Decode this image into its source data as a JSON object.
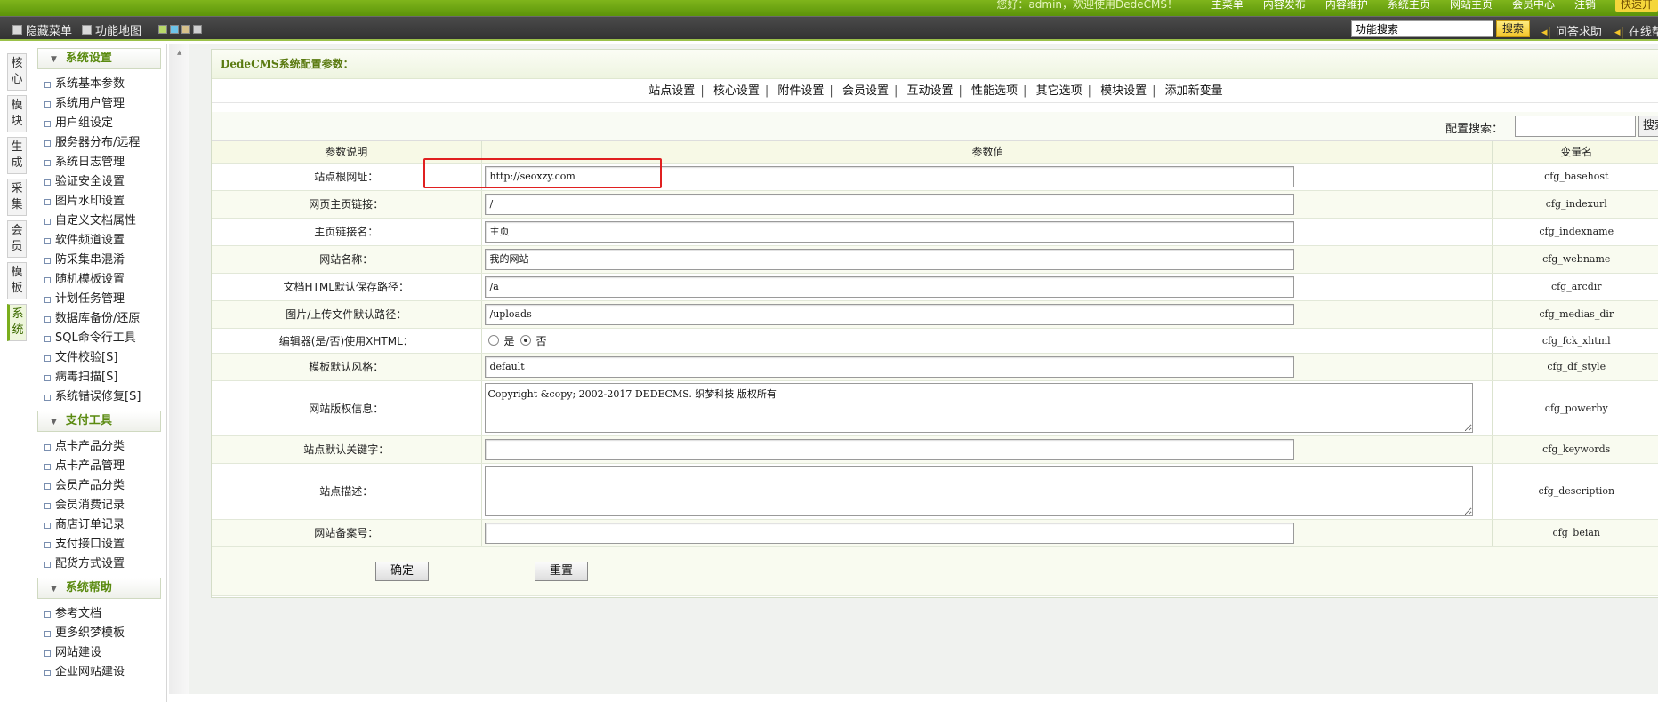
{
  "topbar": {
    "welcome": "您好：admin，欢迎使用DedeCMS！",
    "links": [
      "主菜单",
      "内容发布",
      "内容维护",
      "系统主页",
      "网站主页",
      "会员中心",
      "注销",
      "快速开"
    ]
  },
  "toolbar": {
    "hide_menu": "隐藏菜单",
    "func_map": "功能地图",
    "search_value": "功能搜索",
    "search_btn": "搜索",
    "help": "问答求助",
    "online": "在线帮",
    "swatch_colors": [
      "#b8d86a",
      "#6cc3e8",
      "#d6c08a",
      "#d0d0d0"
    ]
  },
  "vtabs": [
    "核心",
    "模块",
    "生成",
    "采集",
    "会员",
    "模板",
    "系统"
  ],
  "sidebar": {
    "sections": [
      {
        "title": "系统设置",
        "items": [
          "系统基本参数",
          "系统用户管理",
          "用户组设定",
          "服务器分布/远程",
          "系统日志管理",
          "验证安全设置",
          "图片水印设置",
          "自定义文档属性",
          "软件频道设置",
          "防采集串混淆",
          "随机模板设置",
          "计划任务管理",
          "数据库备份/还原",
          "SQL命令行工具",
          "文件校验[S]",
          "病毒扫描[S]",
          "系统错误修复[S]"
        ]
      },
      {
        "title": "支付工具",
        "items": [
          "点卡产品分类",
          "点卡产品管理",
          "会员产品分类",
          "会员消费记录",
          "商店订单记录",
          "支付接口设置",
          "配货方式设置"
        ]
      },
      {
        "title": "系统帮助",
        "items": [
          "参考文档",
          "更多织梦模板",
          "网站建设",
          "企业网站建设"
        ]
      }
    ]
  },
  "panel": {
    "title": "DedeCMS系统配置参数：",
    "nav": [
      "站点设置",
      "核心设置",
      "附件设置",
      "会员设置",
      "互动设置",
      "性能选项",
      "其它选项",
      "模块设置",
      "添加新变量"
    ],
    "cfg_search_label": "配置搜索：",
    "cfg_search_btn": "搜索",
    "headers": [
      "参数说明",
      "参数值",
      "变量名"
    ],
    "rows": [
      {
        "label": "站点根网址：",
        "type": "text",
        "value": "http://seoxzy.com",
        "var": "cfg_basehost"
      },
      {
        "label": "网页主页链接：",
        "type": "text",
        "value": "/",
        "var": "cfg_indexurl"
      },
      {
        "label": "主页链接名：",
        "type": "text",
        "value": "主页",
        "var": "cfg_indexname"
      },
      {
        "label": "网站名称：",
        "type": "text",
        "value": "我的网站",
        "var": "cfg_webname"
      },
      {
        "label": "文档HTML默认保存路径：",
        "type": "text",
        "value": "/a",
        "var": "cfg_arcdir"
      },
      {
        "label": "图片/上传文件默认路径：",
        "type": "text",
        "value": "/uploads",
        "var": "cfg_medias_dir"
      },
      {
        "label": "编辑器(是/否)使用XHTML：",
        "type": "radio",
        "yes": "是",
        "no": "否",
        "selected": "否",
        "var": "cfg_fck_xhtml"
      },
      {
        "label": "模板默认风格：",
        "type": "text",
        "value": "default",
        "var": "cfg_df_style"
      },
      {
        "label": "网站版权信息：",
        "type": "textarea",
        "value": "Copyright &copy; 2002-2017 DEDECMS. 织梦科技 版权所有",
        "var": "cfg_powerby"
      },
      {
        "label": "站点默认关键字：",
        "type": "text",
        "value": "",
        "var": "cfg_keywords"
      },
      {
        "label": "站点描述：",
        "type": "textarea",
        "value": "",
        "var": "cfg_description"
      },
      {
        "label": "网站备案号：",
        "type": "text",
        "value": "",
        "var": "cfg_beian"
      }
    ],
    "ok_btn": "确定",
    "reset_btn": "重置"
  }
}
